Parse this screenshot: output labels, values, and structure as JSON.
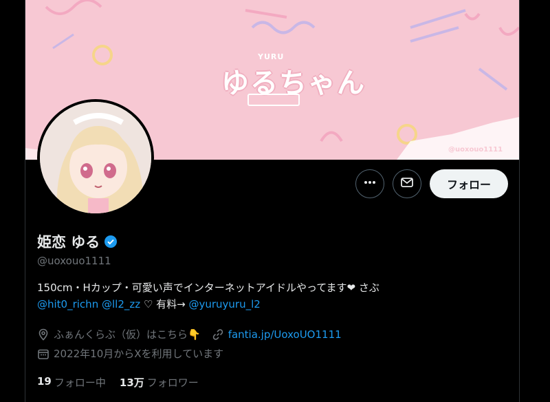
{
  "banner": {
    "small_text": "YURU",
    "title_text": "ゆるちゃん",
    "handle_text": "@uoxouo1111",
    "bg_color": "#f7c8d3"
  },
  "actions": {
    "more_icon": "more-dots-icon",
    "message_icon": "envelope-icon",
    "follow_label": "フォロー"
  },
  "profile": {
    "display_name": "姫恋 ゆる",
    "verified_icon": "verified-badge-icon",
    "handle": "@uoxouo1111",
    "bio_line1": "150cm・Hカップ・可愛い声でインターネットアイドルやってます❤ さぶ",
    "bio_mention1": "@hit0_richn",
    "bio_mention2": "@ll2_zz",
    "bio_heart": " ♡ 有料→",
    "bio_mention3": "@yuruyuru_l2",
    "location": "ふぁんくらぶ（仮）はこちら👇",
    "website": "fantia.jp/UoxoUO1111",
    "joined": "2022年10月からXを利用しています"
  },
  "stats": {
    "following_count": "19",
    "following_label": "フォロー中",
    "followers_count": "13万",
    "followers_label": "フォロワー"
  },
  "colors": {
    "accent": "#1d9bf0",
    "muted": "#71767b",
    "text": "#e7e9ea"
  }
}
